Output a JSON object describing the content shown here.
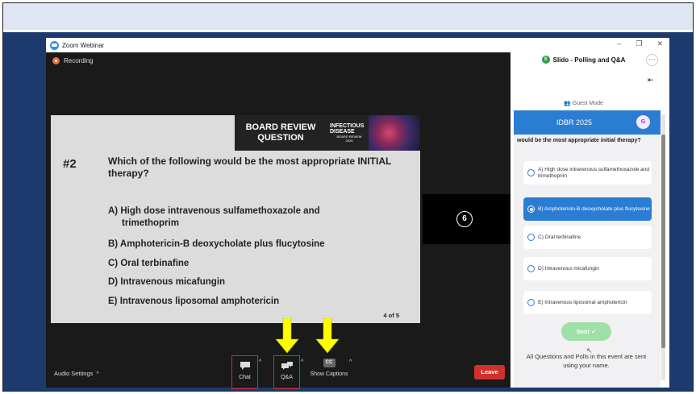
{
  "window": {
    "title": "Zoom Webinar",
    "recording": "Recording"
  },
  "slide": {
    "banner_line1": "BOARD REVIEW",
    "banner_line2": "QUESTION",
    "logo_line1": "INFECTIOUS DISEASE",
    "logo_line2": "BOARD REVIEW",
    "logo_line3": "2025",
    "number": "#2",
    "question": "Which of the following would be the most appropriate INITIAL therapy?",
    "options": [
      "A) High dose intravenous sulfamethoxazole and",
      "trimethoprim",
      "B) Amphotericin-B deoxycholate plus flucytosine",
      "C) Oral terbinafine",
      "D) Intravenous micafungin",
      "E) Intravenous liposomal amphotericin"
    ],
    "page": "4 of 5"
  },
  "video_badge": "6",
  "toolbar": {
    "audio": "Audio Settings",
    "chat": "Chat",
    "qa": "Q&A",
    "cc_icon": "CC",
    "captions": "Show Captions",
    "leave": "Leave"
  },
  "slido": {
    "title": "Slido - Polling and Q&A",
    "more": "···",
    "guest_mode": "Guest Mode",
    "event": "IDBR 2025",
    "avatar": "G",
    "question_fragment": "would be the most appropriate initial therapy?",
    "options": [
      {
        "label": "A) High dose intravenous sulfamethoxazole and trimethoprim",
        "selected": false
      },
      {
        "label": "B) Amphotericin-B deoxycholate plus flucytosine",
        "selected": true
      },
      {
        "label": "C) Oral terbinafine",
        "selected": false
      },
      {
        "label": "D) Intravenous micafungin",
        "selected": false
      },
      {
        "label": "E) Intravenous liposomal amphotericin",
        "selected": false
      }
    ],
    "sent": "Sent ✓",
    "footer": "All Questions and Polls in this event are sent using your name."
  },
  "colors": {
    "accent": "#2b7cd3",
    "leave": "#d0312d",
    "arrow": "#ffff00",
    "highlight_box": "#d42a2a"
  }
}
